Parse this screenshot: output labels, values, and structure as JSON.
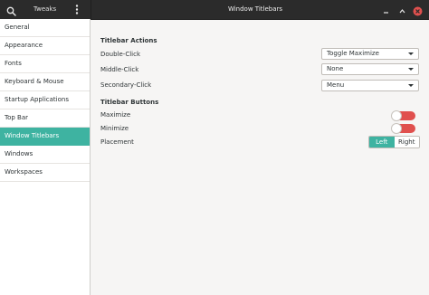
{
  "header": {
    "app_name": "Tweaks",
    "window_title": "Window Titlebars",
    "icons": {
      "search": "search-icon",
      "menu": "vertical-dots-menu-icon",
      "minimize": "minimize-icon",
      "maximize": "maximize-icon",
      "close": "close-icon"
    },
    "close_color": "#e0504e"
  },
  "sidebar": {
    "items": [
      {
        "label": "General"
      },
      {
        "label": "Appearance"
      },
      {
        "label": "Fonts"
      },
      {
        "label": "Keyboard & Mouse"
      },
      {
        "label": "Startup Applications"
      },
      {
        "label": "Top Bar"
      },
      {
        "label": "Window Titlebars"
      },
      {
        "label": "Windows"
      },
      {
        "label": "Workspaces"
      }
    ],
    "selected": "Window Titlebars",
    "accent_color": "#3eb3a1"
  },
  "titlebar_actions": {
    "heading": "Titlebar Actions",
    "double_click": {
      "label": "Double-Click",
      "value": "Toggle Maximize"
    },
    "middle_click": {
      "label": "Middle-Click",
      "value": "None"
    },
    "secondary_click": {
      "label": "Secondary-Click",
      "value": "Menu"
    }
  },
  "titlebar_buttons": {
    "heading": "Titlebar Buttons",
    "maximize": {
      "label": "Maximize",
      "enabled": false
    },
    "minimize": {
      "label": "Minimize",
      "enabled": false
    },
    "placement": {
      "label": "Placement",
      "options": [
        "Left",
        "Right"
      ],
      "selected": "Left"
    },
    "toggle_off_color": "#e0504e"
  }
}
